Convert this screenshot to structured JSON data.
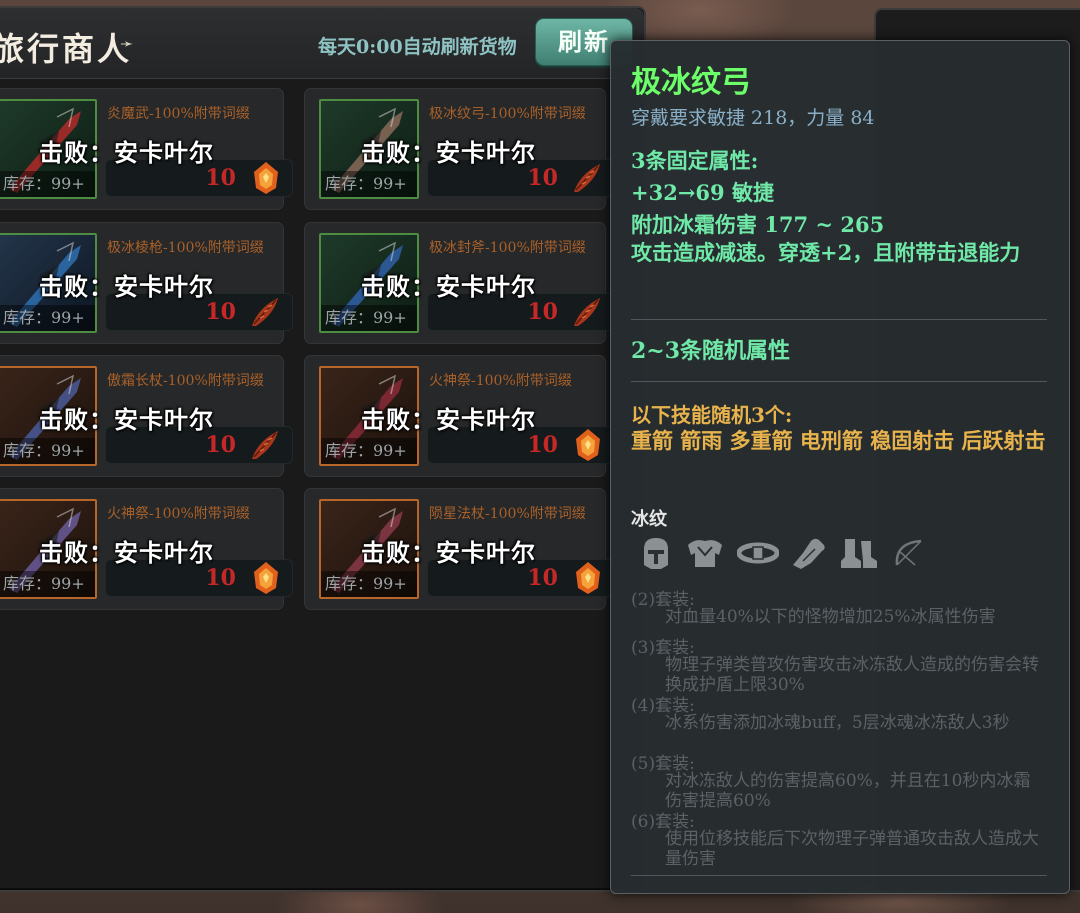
{
  "shop": {
    "title": "旅行商人",
    "refresh_note": "每天0:00自动刷新货物",
    "refresh_button": "刷新",
    "items": [
      {
        "name": "炎魔武-100%附带词缀",
        "overlay": "击败：安卡叶尔",
        "stock": "库存：99+",
        "price": "10",
        "currency": "fire-gem"
      },
      {
        "name": "极冰纹弓-100%附带词缀",
        "overlay": "击败：安卡叶尔",
        "stock": "库存：99+",
        "price": "10",
        "currency": "red-feather"
      },
      {
        "name": "极冰棱枪-100%附带词缀",
        "overlay": "击败：安卡叶尔",
        "stock": "库存：99+",
        "price": "10",
        "currency": "red-feather"
      },
      {
        "name": "极冰封斧-100%附带词缀",
        "overlay": "击败：安卡叶尔",
        "stock": "库存：99+",
        "price": "10",
        "currency": "red-feather"
      },
      {
        "name": "傲霜长杖-100%附带词缀",
        "overlay": "击败：安卡叶尔",
        "stock": "库存：99+",
        "price": "10",
        "currency": "red-feather"
      },
      {
        "name": "火神祭-100%附带词缀",
        "overlay": "击败：安卡叶尔",
        "stock": "库存：99+",
        "price": "10",
        "currency": "fire-gem"
      },
      {
        "name": "火神祭-100%附带词缀",
        "overlay": "击败：安卡叶尔",
        "stock": "库存：99+",
        "price": "10",
        "currency": "fire-gem"
      },
      {
        "name": "陨星法杖-100%附带词缀",
        "overlay": "击败：安卡叶尔",
        "stock": "库存：99+",
        "price": "10",
        "currency": "fire-gem"
      }
    ]
  },
  "tooltip": {
    "name": "极冰纹弓",
    "requirement": "穿戴要求敏捷 218，力量 84",
    "fixed_header": "3条固定属性:",
    "fixed_stat_1": "+32→69 敏捷",
    "fixed_stat_2": "附加冰霜伤害 177 ~ 265",
    "fixed_stat_3": "攻击造成减速。穿透+2，且附带击退能力",
    "random_header": "2~3条随机属性",
    "skills_header": "以下技能随机3个:",
    "skills": "重箭 箭雨 多重箭 电刑箭 稳固射击 后跃射击",
    "set_name": "冰纹",
    "set_icons": [
      "helmet-icon",
      "armor-icon",
      "belt-icon",
      "glove-icon",
      "boots-icon",
      "bow-icon"
    ],
    "set_bonuses": [
      {
        "tier": "(2)套装:",
        "desc": "对血量40%以下的怪物增加25%冰属性伤害"
      },
      {
        "tier": "(3)套装:",
        "desc": "物理子弹类普攻伤害攻击冰冻敌人造成的伤害会转换成护盾上限30%"
      },
      {
        "tier": "(4)套装:",
        "desc": "冰系伤害添加冰魂buff，5层冰魂冰冻敌人3秒"
      },
      {
        "tier": "(5)套装:",
        "desc": "对冰冻敌人的伤害提高60%，并且在10秒内冰霜伤害提高60%"
      },
      {
        "tier": "(6)套装:",
        "desc": "使用位移技能后下次物理子弹普通攻击敌人造成大量伤害"
      }
    ]
  },
  "colors": {
    "tooltip_name": "#6cff69",
    "stat_green": "#6fe8a8",
    "skill_gold": "#e8b34c",
    "price_red": "#c62828",
    "item_name_orange": "#b8672a"
  }
}
